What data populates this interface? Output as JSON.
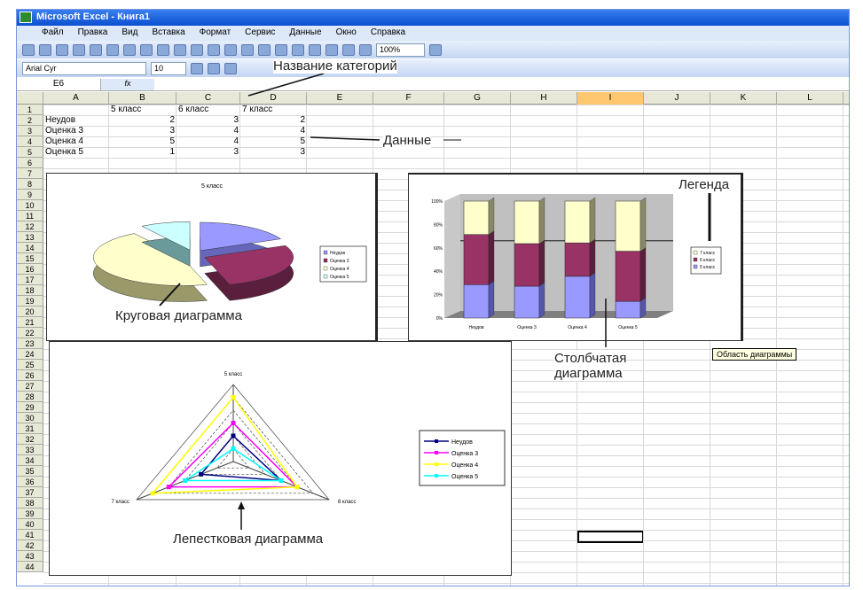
{
  "window": {
    "title": "Microsoft Excel - Книга1"
  },
  "menu": [
    "Файл",
    "Правка",
    "Вид",
    "Вставка",
    "Формат",
    "Сервис",
    "Данные",
    "Окно",
    "Справка"
  ],
  "toolbar": {
    "zoom": "100%",
    "font": "Arial Cyr",
    "font_size": "10"
  },
  "formula_bar": {
    "name_box": "E6",
    "fx": "fx",
    "value": ""
  },
  "columns": [
    "A",
    "B",
    "C",
    "D",
    "E",
    "F",
    "G",
    "H",
    "I",
    "J",
    "K",
    "L"
  ],
  "rows": [
    "1",
    "2",
    "3",
    "4",
    "5",
    "6",
    "7",
    "8",
    "9",
    "10",
    "11",
    "12",
    "13",
    "14",
    "15",
    "16",
    "17",
    "18",
    "19",
    "20",
    "21",
    "22",
    "23",
    "24",
    "25",
    "26",
    "27",
    "28",
    "29",
    "30",
    "31",
    "32",
    "33",
    "34",
    "35",
    "36",
    "37",
    "38",
    "39",
    "40",
    "41",
    "42",
    "43",
    "44"
  ],
  "table": {
    "headers": [
      "5 класс",
      "6 класс",
      "7 класс"
    ],
    "rows": [
      {
        "label": "Неудов",
        "values": [
          2,
          3,
          2
        ]
      },
      {
        "label": "Оценка 3",
        "values": [
          3,
          4,
          4
        ]
      },
      {
        "label": "Оценка 4",
        "values": [
          5,
          4,
          5
        ]
      },
      {
        "label": "Оценка 5",
        "values": [
          1,
          3,
          3
        ]
      }
    ]
  },
  "annotations": {
    "category_name": "Название категорий",
    "data": "Данные",
    "legend": "Легенда",
    "pie": "Круговая диаграмма",
    "bar_line1": "Столбчатая",
    "bar_line2": "диаграмма",
    "radar": "Лепестковая диаграмма",
    "tooltip": "Область диаграммы"
  },
  "colors": {
    "s1": "#9999ff",
    "s2": "#993366",
    "s3": "#ffffcc",
    "s4": "#ccffff",
    "r1": "#000080",
    "r2": "#ff00ff",
    "r3": "#ffff00",
    "r4": "#00ffff"
  },
  "chart_data": [
    {
      "type": "pie",
      "title": "5 класс",
      "categories": [
        "Неудов",
        "Оценка 3",
        "Оценка 4",
        "Оценка 5"
      ],
      "values": [
        2,
        3,
        5,
        1
      ],
      "legend": "right"
    },
    {
      "type": "bar",
      "stacked": "percent",
      "categories": [
        "Неудов",
        "Оценка 3",
        "Оценка 4",
        "Оценка 5"
      ],
      "series": [
        {
          "name": "5 класс",
          "values": [
            2,
            3,
            5,
            1
          ]
        },
        {
          "name": "6 класс",
          "values": [
            3,
            4,
            4,
            3
          ]
        },
        {
          "name": "7 класс",
          "values": [
            2,
            4,
            5,
            3
          ]
        }
      ],
      "yticks": [
        "0%",
        "20%",
        "40%",
        "60%",
        "80%",
        "100%"
      ],
      "legend": "right"
    },
    {
      "type": "radar",
      "categories": [
        "5 класс",
        "6 класс",
        "7 класс"
      ],
      "series": [
        {
          "name": "Неудов",
          "values": [
            2,
            3,
            2
          ]
        },
        {
          "name": "Оценка 3",
          "values": [
            3,
            4,
            4
          ]
        },
        {
          "name": "Оценка 4",
          "values": [
            5,
            4,
            5
          ]
        },
        {
          "name": "Оценка 5",
          "values": [
            1,
            3,
            3
          ]
        }
      ],
      "rmax": 6,
      "legend": "right"
    }
  ]
}
